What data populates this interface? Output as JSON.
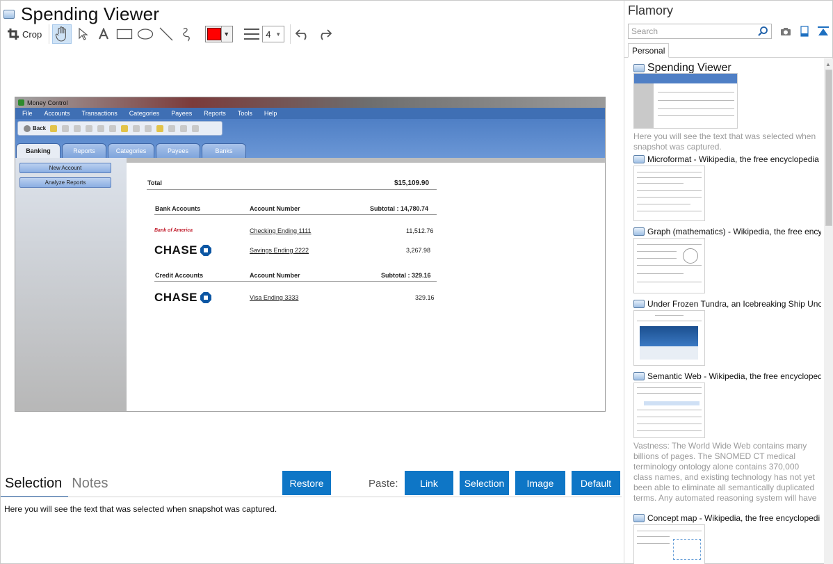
{
  "window": {
    "title": "Spending Viewer"
  },
  "toolbar": {
    "crop_label": "Crop",
    "width_value": "4",
    "color": "#ff0000"
  },
  "snapshot": {
    "app_title": "Money Control",
    "menu": [
      "File",
      "Accounts",
      "Transactions",
      "Categories",
      "Payees",
      "Reports",
      "Tools",
      "Help"
    ],
    "back_label": "Back",
    "tabs": [
      "Banking",
      "Reports",
      "Categories",
      "Payees",
      "Banks"
    ],
    "side_buttons": [
      "New Account",
      "Analyze Reports"
    ],
    "total_label": "Total",
    "total_value": "$15,109.90",
    "bank_header": {
      "name": "Bank Accounts",
      "number": "Account Number",
      "subtotal": "Subtotal : 14,780.74"
    },
    "bank_rows": [
      {
        "bank": "Bank of America",
        "account": "Checking Ending 1111",
        "amount": "11,512.76"
      },
      {
        "bank": "CHASE",
        "account": "Savings Ending 2222",
        "amount": "3,267.98"
      }
    ],
    "credit_header": {
      "name": "Credit Accounts",
      "number": "Account Number",
      "subtotal": "Subtotal : 329.16"
    },
    "credit_rows": [
      {
        "bank": "CHASE",
        "account": "Visa Ending 3333",
        "amount": "329.16"
      }
    ]
  },
  "bottom": {
    "tabs": [
      "Selection",
      "Notes"
    ],
    "restore_label": "Restore",
    "paste_label": "Paste:",
    "paste_buttons": [
      "Link",
      "Selection",
      "Image",
      "Default"
    ],
    "selection_text": "Here you will see the text that was selected when snapshot was captured."
  },
  "flamory": {
    "title": "Flamory",
    "search_placeholder": "Search",
    "tab": "Personal",
    "items": [
      {
        "title": "Spending Viewer",
        "desc": "Here you will see the text that was selected when snapshot was captured."
      },
      {
        "title": "Microformat - Wikipedia, the free encyclopedia"
      },
      {
        "title": "Graph (mathematics) - Wikipedia, the free ency"
      },
      {
        "title": "Under Frozen Tundra, an Icebreaking Ship Unco"
      },
      {
        "title": "Semantic Web - Wikipedia, the free encycloped",
        "desc": "Vastness: The World Wide Web contains many billions of pages. The SNOMED CT medical terminology ontology alone contains 370,000 class names, and existing technology has not yet been able to eliminate all semantically duplicated terms. Any automated reasoning system will have to deal with truly huge inputs."
      },
      {
        "title": "Concept map - Wikipedia, the free encyclopedi"
      }
    ]
  }
}
